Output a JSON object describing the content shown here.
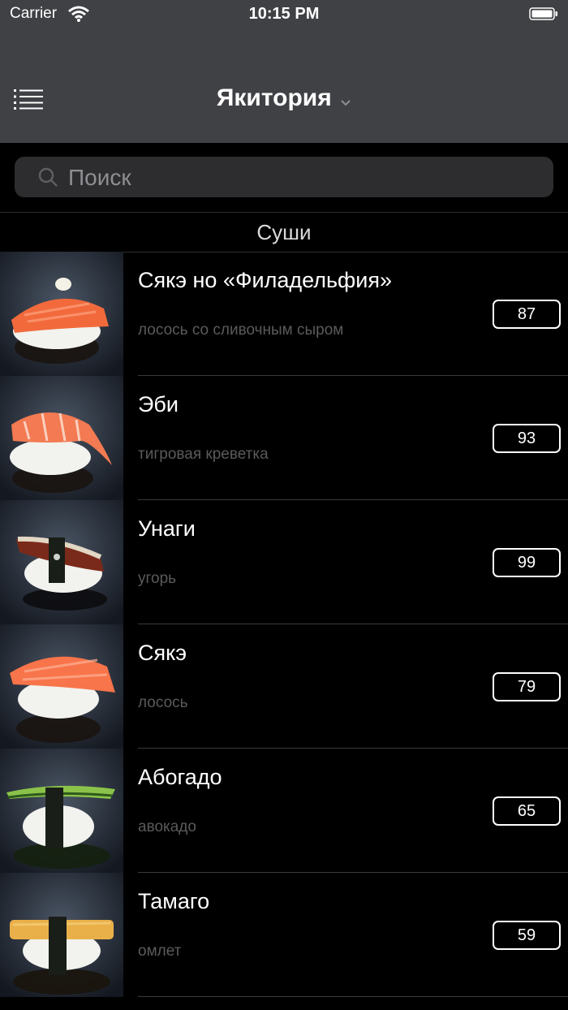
{
  "status_bar": {
    "carrier": "Carrier",
    "time": "10:15 PM"
  },
  "nav": {
    "title": "Якитория"
  },
  "search": {
    "placeholder": "Поиск"
  },
  "section": {
    "title": "Суши"
  },
  "items": [
    {
      "name": "Сякэ но «Филадельфия»",
      "description": "лосось со сливочным сыром",
      "price": "87",
      "topping_color": "#f26a3c"
    },
    {
      "name": "Эби",
      "description": "тигровая креветка",
      "price": "93",
      "topping_color": "#f37a52"
    },
    {
      "name": "Унаги",
      "description": "угорь",
      "price": "99",
      "topping_color": "#7a2a1a"
    },
    {
      "name": "Сякэ",
      "description": "лосось",
      "price": "79",
      "topping_color": "#f8744a"
    },
    {
      "name": "Абогадо",
      "description": "авокадо",
      "price": "65",
      "topping_color": "#8bc34a"
    },
    {
      "name": "Тамаго",
      "description": "омлет",
      "price": "59",
      "topping_color": "#e9b04a"
    }
  ],
  "colors": {
    "bar_bg": "#404145",
    "list_bg": "#000000",
    "description": "#5a5a5a"
  }
}
